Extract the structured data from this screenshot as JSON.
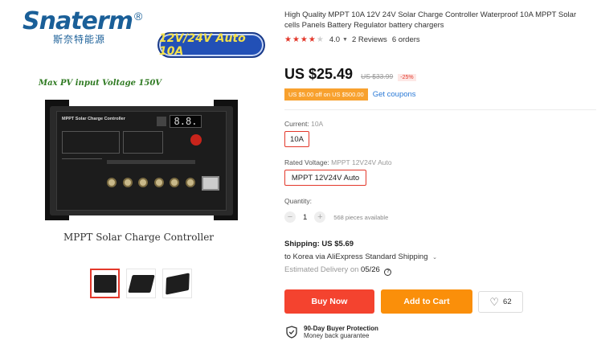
{
  "gallery": {
    "brand_name": "Snaterm",
    "brand_mark": "®",
    "brand_cn": "斯奈特能源",
    "voltage_badge": "12V/24V Auto 10A",
    "pv_text": "Max PV input Voltage 150V",
    "device_title": "MPPT Solar Charge Controller",
    "device_display": "8.8.",
    "caption": "MPPT Solar Charge Controller",
    "thumbnails": [
      {
        "selected": true
      },
      {
        "selected": false
      },
      {
        "selected": false
      }
    ]
  },
  "product": {
    "title": "High Quality MPPT 10A 12V 24V Solar Charge Controller Waterproof 10A MPPT Solar cells Panels Battery Regulator battery chargers",
    "rating_stars": "★★★★",
    "rating_star_empty": "★",
    "rating": "4.0",
    "reviews": "2 Reviews",
    "orders": "6 orders"
  },
  "pricing": {
    "price": "US $25.49",
    "old_price": "US $33.99",
    "discount": "-25%",
    "coupon": "US $5.00 off on US $500.00",
    "get_coupons": "Get coupons"
  },
  "options": {
    "current_label": "Current:",
    "current_value": "10A",
    "current_selected": "10A",
    "voltage_label": "Rated Voltage:",
    "voltage_value": "MPPT 12V24V Auto",
    "voltage_selected": "MPPT 12V24V Auto"
  },
  "quantity": {
    "label": "Quantity:",
    "value": "1",
    "minus": "−",
    "plus": "+",
    "available": "568 pieces available"
  },
  "shipping": {
    "title": "Shipping: US $5.69",
    "via": "to Korea via AliExpress Standard Shipping",
    "eta_prefix": "Estimated Delivery on ",
    "eta_date": "05/26",
    "help": "?"
  },
  "actions": {
    "buy_now": "Buy Now",
    "add_to_cart": "Add to Cart",
    "wishlist_count": "62"
  },
  "protection": {
    "title": "90-Day Buyer Protection",
    "subtitle": "Money back guarantee"
  },
  "colors": {
    "accent_red": "#e3382b",
    "buy_now": "#f4432f",
    "add_to_cart": "#fa8f0a",
    "coupon_bg": "#f8a12e",
    "link_blue": "#2a79d6",
    "brand_blue": "#1a5f98"
  },
  "icons": {
    "rating": "star-icon",
    "chevron": "chevron-down-icon",
    "help": "question-circle-icon",
    "wishlist": "heart-icon",
    "protection": "shield-check-icon",
    "qty_minus": "minus-icon",
    "qty_plus": "plus-icon"
  }
}
